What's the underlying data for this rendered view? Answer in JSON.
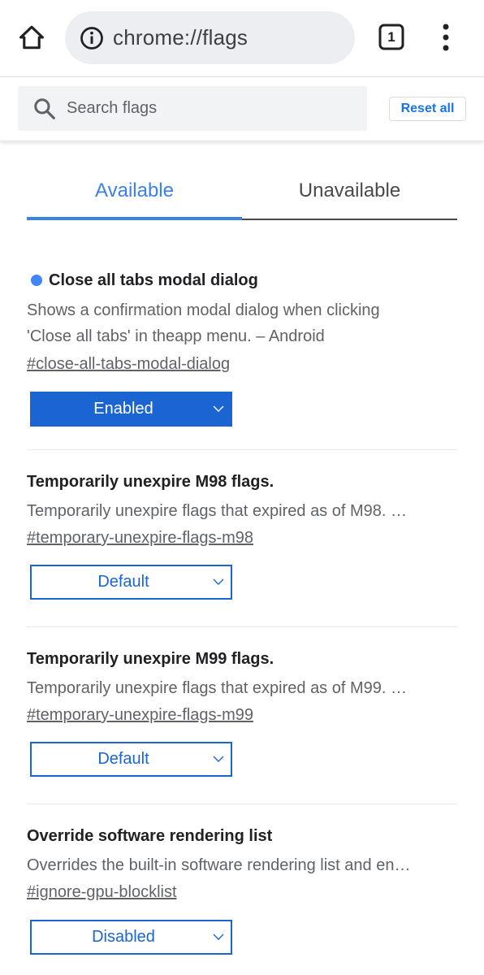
{
  "browser": {
    "url": "chrome://flags",
    "tab_count": "1",
    "icons": {
      "home": "home-icon",
      "info": "info-icon",
      "tabs": "tab-switcher-icon",
      "menu": "more-vertical-icon"
    }
  },
  "search": {
    "placeholder": "Search flags",
    "value": "",
    "reset_label": "Reset all"
  },
  "tabs": [
    {
      "label": "Available",
      "active": true
    },
    {
      "label": "Unavailable",
      "active": false
    }
  ],
  "colors": {
    "accent": "#1a65d1",
    "tab_active": "#3b82e6",
    "modified_dot": "#4285f4"
  },
  "flags": [
    {
      "title": "Close all tabs modal dialog",
      "modified": true,
      "description_lines": [
        "Shows a confirmation modal dialog when clicking",
        "'Close all tabs' in theapp menu. – Android"
      ],
      "link": "#close-all-tabs-modal-dialog",
      "value": "Enabled"
    },
    {
      "title": "Temporarily unexpire M98 flags.",
      "modified": false,
      "description_lines": [
        "Temporarily unexpire flags that expired as of M98. …"
      ],
      "link": "#temporary-unexpire-flags-m98",
      "value": "Default"
    },
    {
      "title": "Temporarily unexpire M99 flags.",
      "modified": false,
      "description_lines": [
        "Temporarily unexpire flags that expired as of M99. …"
      ],
      "link": "#temporary-unexpire-flags-m99",
      "value": "Default"
    },
    {
      "title": "Override software rendering list",
      "modified": false,
      "description_lines": [
        "Overrides the built-in software rendering list and en…"
      ],
      "link": "#ignore-gpu-blocklist",
      "value": "Disabled"
    }
  ]
}
